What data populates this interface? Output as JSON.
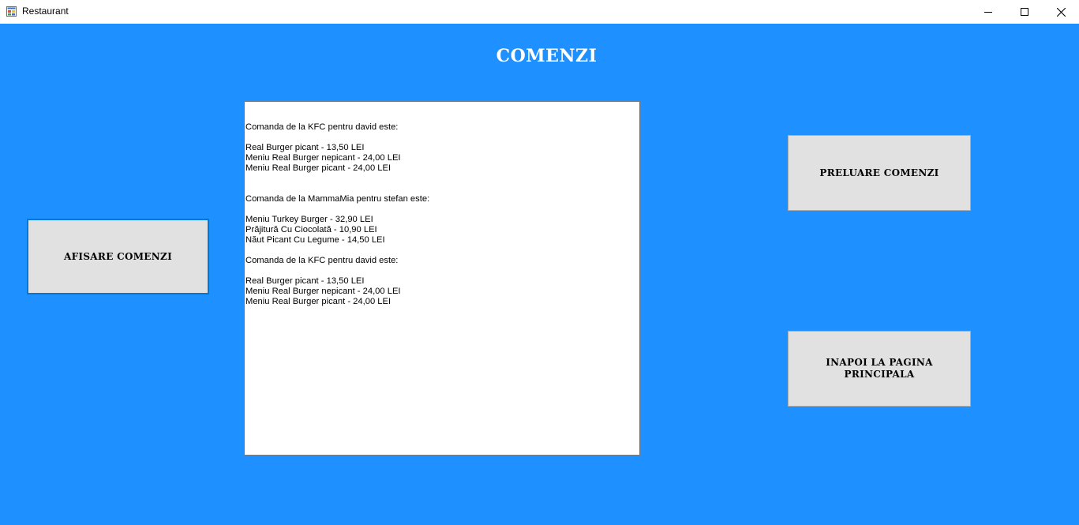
{
  "window": {
    "title": "Restaurant",
    "icons": {
      "app": "app-icon",
      "minimize": "minimize-icon",
      "maximize": "maximize-icon",
      "close": "close-icon"
    }
  },
  "heading": "COMENZI",
  "orders_list": {
    "lines": [
      "",
      "",
      "Comanda de la KFC pentru david este:",
      "",
      "Real Burger picant - 13,50 LEI",
      "Meniu Real Burger nepicant - 24,00 LEI",
      "Meniu Real Burger picant - 24,00 LEI",
      "",
      "",
      "Comanda de la MammaMia pentru stefan este:",
      "",
      "Meniu Turkey Burger - 32,90 LEI",
      "Prăjitură Cu Ciocolată - 10,90 LEI",
      "Năut Picant Cu Legume - 14,50 LEI",
      "",
      "Comanda de la KFC pentru david este:",
      "",
      "Real Burger picant - 13,50 LEI",
      "Meniu Real Burger nepicant - 24,00 LEI",
      "Meniu Real Burger picant - 24,00 LEI"
    ]
  },
  "buttons": {
    "afisare": "AFISARE COMENZI",
    "preluare": "PRELUARE COMENZI",
    "inapoi": "INAPOI LA PAGINA PRINCIPALA"
  },
  "colors": {
    "background": "#1e90ff",
    "button_face": "#e1e1e1",
    "focus_border": "#0078d7"
  }
}
